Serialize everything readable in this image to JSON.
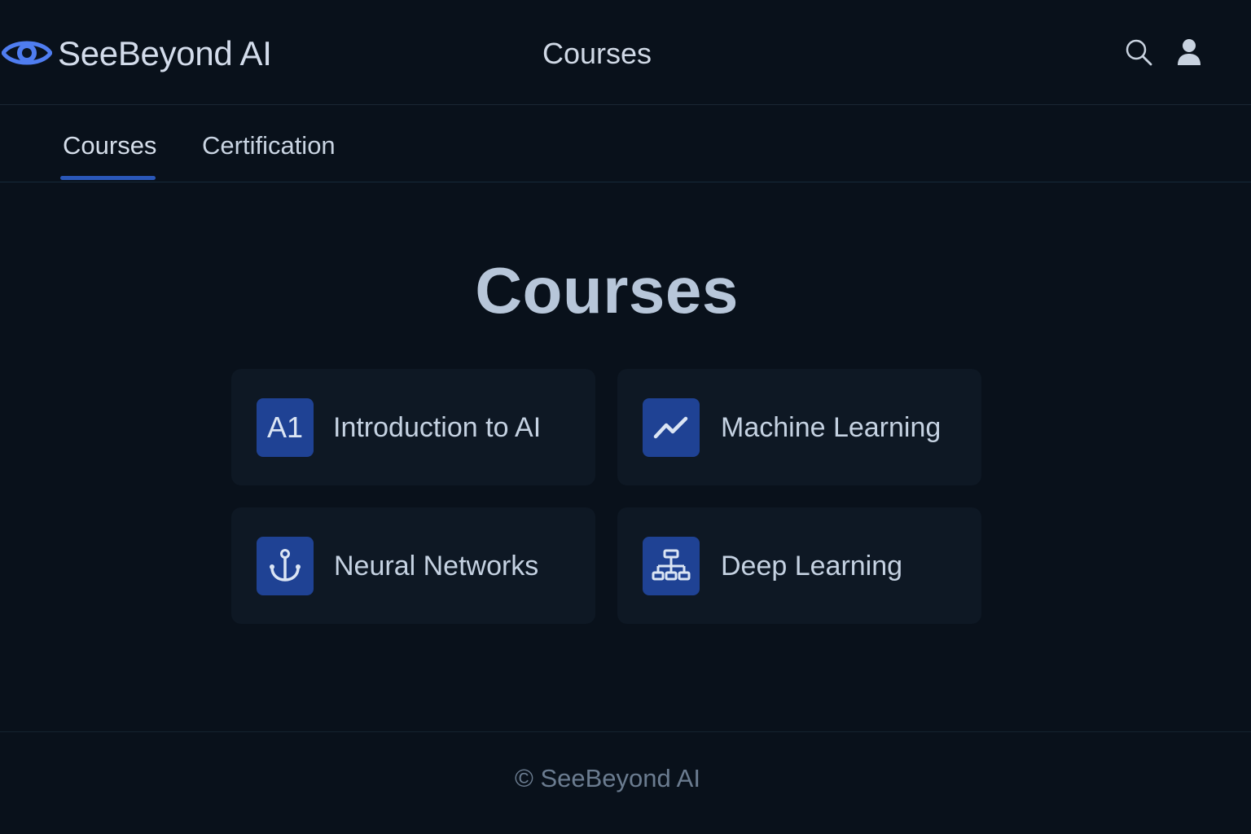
{
  "header": {
    "brand": "SeeBeyond AI",
    "page_title": "Courses",
    "logo_icon": "eye-icon",
    "actions": [
      {
        "name": "search",
        "icon": "search-icon"
      },
      {
        "name": "account",
        "icon": "user-icon"
      }
    ]
  },
  "tabs": [
    {
      "label": "Courses",
      "active": true
    },
    {
      "label": "Certification",
      "active": false
    }
  ],
  "main": {
    "title": "Courses",
    "courses": [
      {
        "label": "Introduction to AI",
        "icon": "ai-text-icon",
        "icon_text": "A1"
      },
      {
        "label": "Machine Learning",
        "icon": "trend-line-icon"
      },
      {
        "label": "Neural Networks",
        "icon": "anchor-icon"
      },
      {
        "label": "Deep Learning",
        "icon": "hierarchy-icon"
      }
    ]
  },
  "footer": {
    "text": "© SeeBeyond AI"
  },
  "colors": {
    "background": "#09111b",
    "card": "#0e1824",
    "accent": "#2a57b8",
    "icon_tile": "#1f4294",
    "logo": "#4f7df0"
  }
}
